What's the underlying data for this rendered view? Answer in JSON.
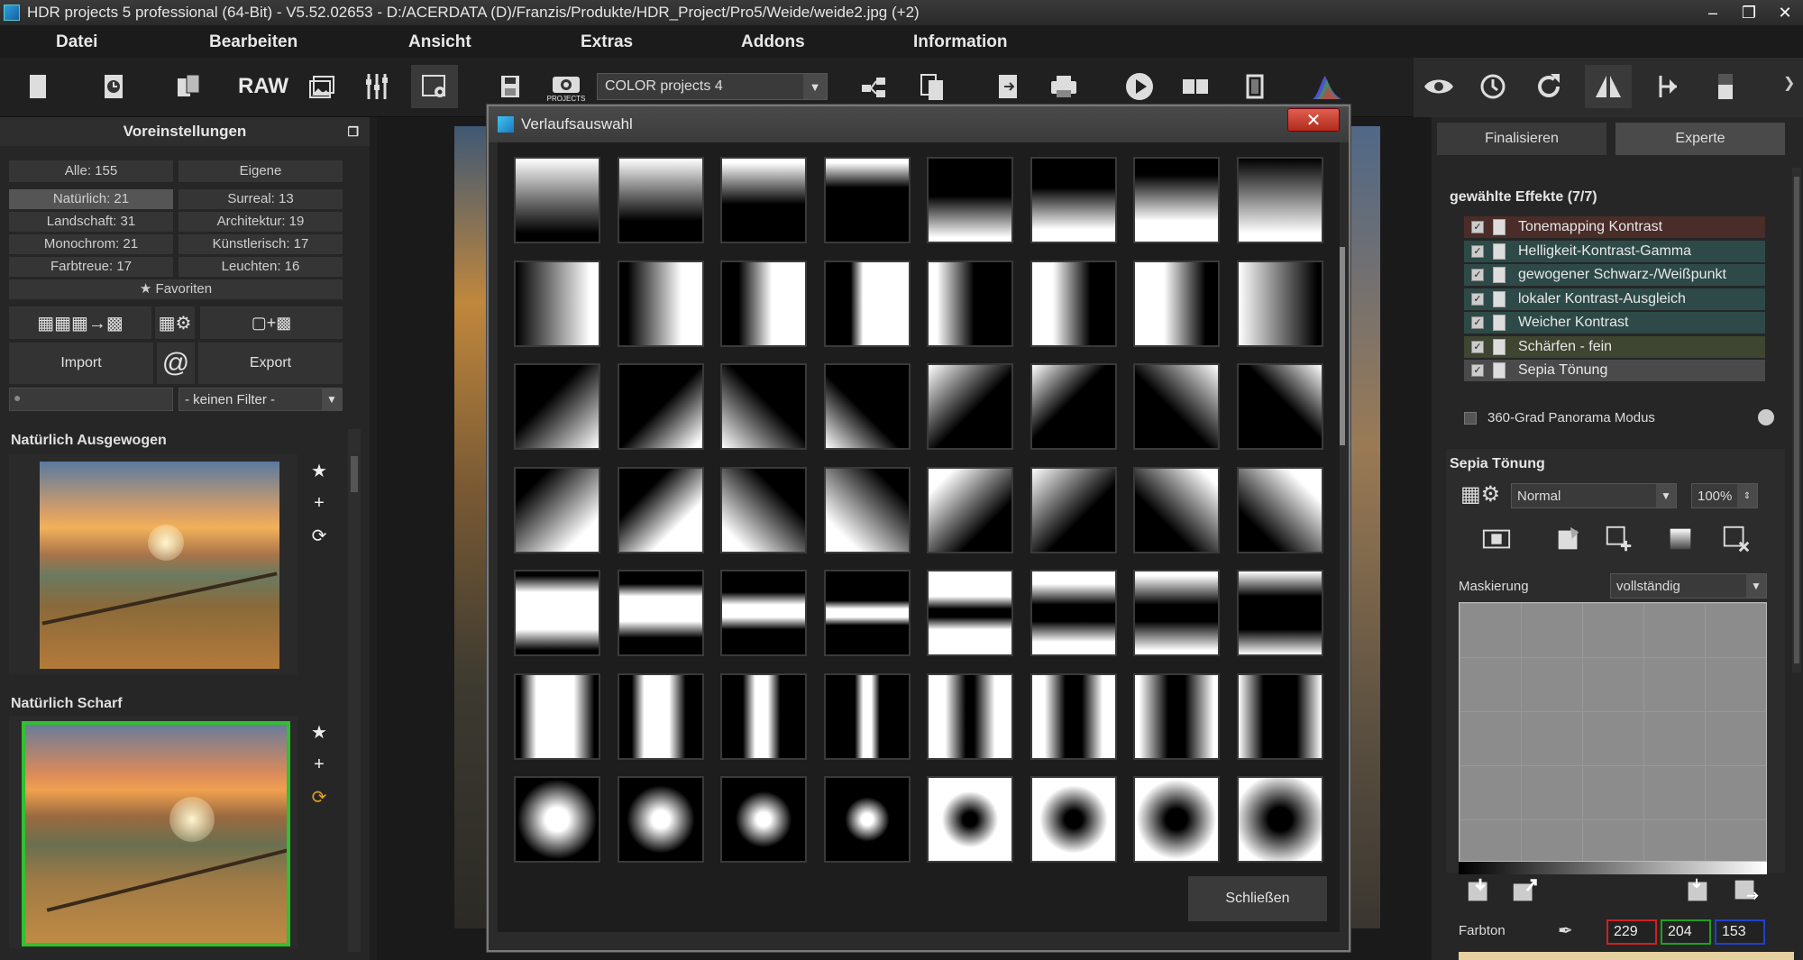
{
  "window": {
    "title": "HDR projects 5 professional (64-Bit) - V5.52.02653 - D:/ACERDATA (D)/Franzis/Produkte/HDR_Project/Pro5/Weide/weide2.jpg (+2)"
  },
  "menu": [
    "Datei",
    "Bearbeiten",
    "Ansicht",
    "Extras",
    "Addons",
    "Information"
  ],
  "toolbar": {
    "raw_label": "RAW",
    "projects_label": "PROJECTS",
    "target_select": "COLOR projects 4"
  },
  "presets": {
    "header": "Voreinstellungen",
    "categories": [
      {
        "label": "Alle: 155"
      },
      {
        "label": "Eigene"
      },
      {
        "label": "Natürlich: 21"
      },
      {
        "label": "Surreal: 13"
      },
      {
        "label": "Landschaft: 31"
      },
      {
        "label": "Architektur: 19"
      },
      {
        "label": "Monochrom: 21"
      },
      {
        "label": "Künstlerisch: 17"
      },
      {
        "label": "Farbtreue: 17"
      },
      {
        "label": "Leuchten: 16"
      }
    ],
    "favorites": "Favoriten",
    "import": "Import",
    "export": "Export",
    "filter": "- keinen Filter -",
    "items": [
      {
        "title": "Natürlich Ausgewogen"
      },
      {
        "title": "Natürlich Scharf"
      }
    ]
  },
  "right": {
    "tabs": [
      "Finalisieren",
      "Experte"
    ],
    "effects_title": "gewählte Effekte (7/7)",
    "effects": [
      {
        "label": "Tonemapping Kontrast",
        "color": "#4a2c28"
      },
      {
        "label": "Helligkeit-Kontrast-Gamma",
        "color": "#2d4a48"
      },
      {
        "label": "gewogener Schwarz-/Weißpunkt",
        "color": "#2d4a48"
      },
      {
        "label": "lokaler Kontrast-Ausgleich",
        "color": "#2d4a48"
      },
      {
        "label": "Weicher Kontrast",
        "color": "#2d4a48"
      },
      {
        "label": "Schärfen - fein",
        "color": "#3e4530"
      },
      {
        "label": "Sepia Tönung",
        "color": "#4a4a4a"
      }
    ],
    "panorama": "360-Grad Panorama Modus",
    "sepia_title": "Sepia Tönung",
    "blend_mode": "Normal",
    "opacity": "100%",
    "mask_label": "Maskierung",
    "mask_value": "vollständig",
    "hue_label": "Farbton",
    "rgb": [
      "229",
      "204",
      "153"
    ]
  },
  "dialog": {
    "title": "Verlaufsauswahl",
    "close_label": "Schließen"
  }
}
